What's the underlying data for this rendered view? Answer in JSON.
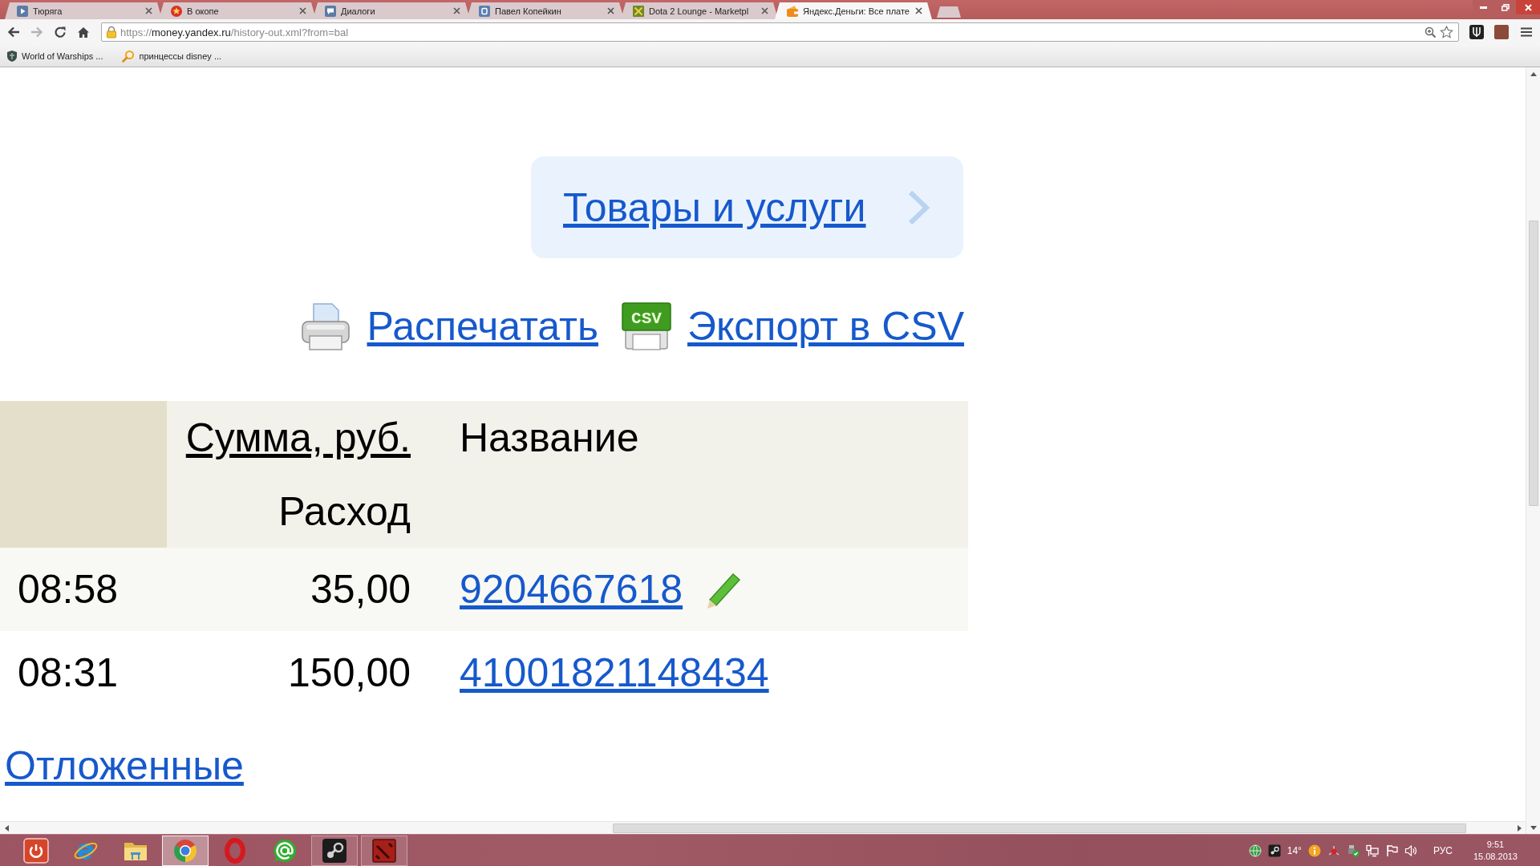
{
  "browser": {
    "tabs": [
      {
        "title": "Тюряга",
        "kind": "play",
        "selected": false
      },
      {
        "title": "В окопе",
        "kind": "star",
        "selected": false
      },
      {
        "title": "Диалоги",
        "kind": "chat",
        "selected": false
      },
      {
        "title": "Павел Копейкин",
        "kind": "tile",
        "selected": false
      },
      {
        "title": "Dota 2 Lounge - Marketpl",
        "kind": "swords",
        "selected": false
      },
      {
        "title": "Яндекс.Деньги: Все плате",
        "kind": "wallet",
        "selected": true
      }
    ],
    "can_go_forward": false,
    "address": {
      "scheme": "https://",
      "host": "money.yandex.ru",
      "path": "/history-out.xml?from=bal"
    },
    "bookmarked": false,
    "bookmarks": [
      {
        "label": "World of Warships ...",
        "kind": "shield"
      },
      {
        "label": "принцессы disney ...",
        "kind": "search"
      }
    ]
  },
  "page": {
    "services_link": "Товары и услуги",
    "actions": [
      {
        "label": "Распечатать",
        "kind": "print"
      },
      {
        "label": "Экспорт в CSV",
        "kind": "csv",
        "icon_label": "CSV"
      }
    ],
    "table": {
      "columns": [
        {
          "sorted": true
        },
        {
          "label": "Сумма, руб.",
          "sub_label": "Расход",
          "sortable": true,
          "sorted": false
        },
        {
          "label": "Название",
          "sortable": false,
          "sorted": false
        }
      ],
      "rows": [
        {
          "column_1": "08:58",
          "column_2": "35,00",
          "column_3": "9204667618",
          "hovered": true
        },
        {
          "column_1": "08:31",
          "column_2": "150,00",
          "column_3": "41001821148434",
          "hovered": false
        }
      ]
    },
    "pending_link": "Отложенные"
  },
  "taskbar": {
    "apps": [
      {
        "kind": "power",
        "open": false,
        "selected": false
      },
      {
        "kind": "ie",
        "open": false,
        "selected": false
      },
      {
        "kind": "explorer",
        "open": false,
        "selected": false
      },
      {
        "kind": "chrome",
        "open": true,
        "selected": true
      },
      {
        "kind": "opera",
        "open": false,
        "selected": false
      },
      {
        "kind": "mail",
        "open": false,
        "selected": false
      },
      {
        "kind": "steam",
        "open": true,
        "selected": false
      },
      {
        "kind": "dota",
        "open": true,
        "selected": false
      }
    ],
    "tray": {
      "items": [
        {
          "kind": "globe"
        },
        {
          "kind": "steam"
        },
        {
          "kind": "weather",
          "text": "14°"
        },
        {
          "kind": "info"
        },
        {
          "kind": "network_error"
        },
        {
          "kind": "usb"
        },
        {
          "kind": "network"
        },
        {
          "kind": "flag"
        },
        {
          "kind": "volume"
        }
      ],
      "language": "РУС",
      "time": "9:51",
      "date": "15.08.2013"
    }
  }
}
